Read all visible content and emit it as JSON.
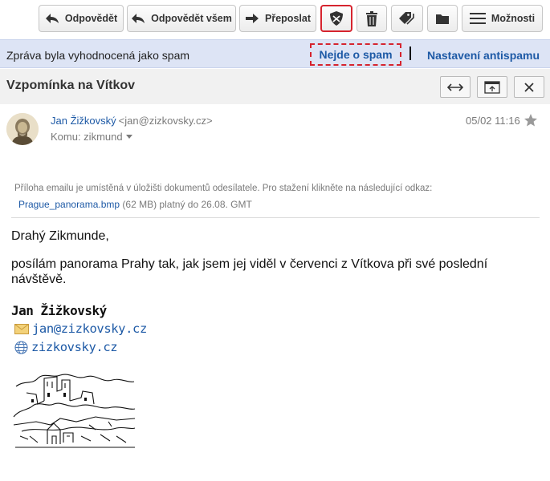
{
  "toolbar": {
    "reply_label": "Odpovědět",
    "reply_all_label": "Odpovědět všem",
    "forward_label": "Přeposlat",
    "more_label": "Možnosti"
  },
  "spam": {
    "message": "Zpráva byla vyhodnocená jako spam",
    "not_spam_label": "Nejde o spam",
    "settings_label": "Nastavení antispamu"
  },
  "email": {
    "subject": "Vzpomínka na Vítkov",
    "from_name": "Jan Žižkovský",
    "from_email": "<jan@zizkovsky.cz>",
    "to_line": "Komu: zikmund",
    "date": "05/02 11:16"
  },
  "attachment": {
    "note": "Příloha emailu je umístěná v úložišti dokumentů odesílatele. Pro stažení klikněte na následující odkaz:",
    "file_name": "Prague_panorama.bmp",
    "details": " (62 MB) platný do 26.08. GMT"
  },
  "body": {
    "greeting": "Drahý Zikmunde,",
    "paragraph": "posílám panorama Prahy tak, jak jsem jej viděl v červenci z Vítkova při své poslední návštěvě."
  },
  "signature": {
    "name": "Jan Žižkovský",
    "email": "jan@zizkovsky.cz",
    "website": "zizkovsky.cz"
  },
  "colors": {
    "link": "#1e5aa6",
    "highlight": "#d6242f",
    "spam_bar": "#dde4f5"
  }
}
